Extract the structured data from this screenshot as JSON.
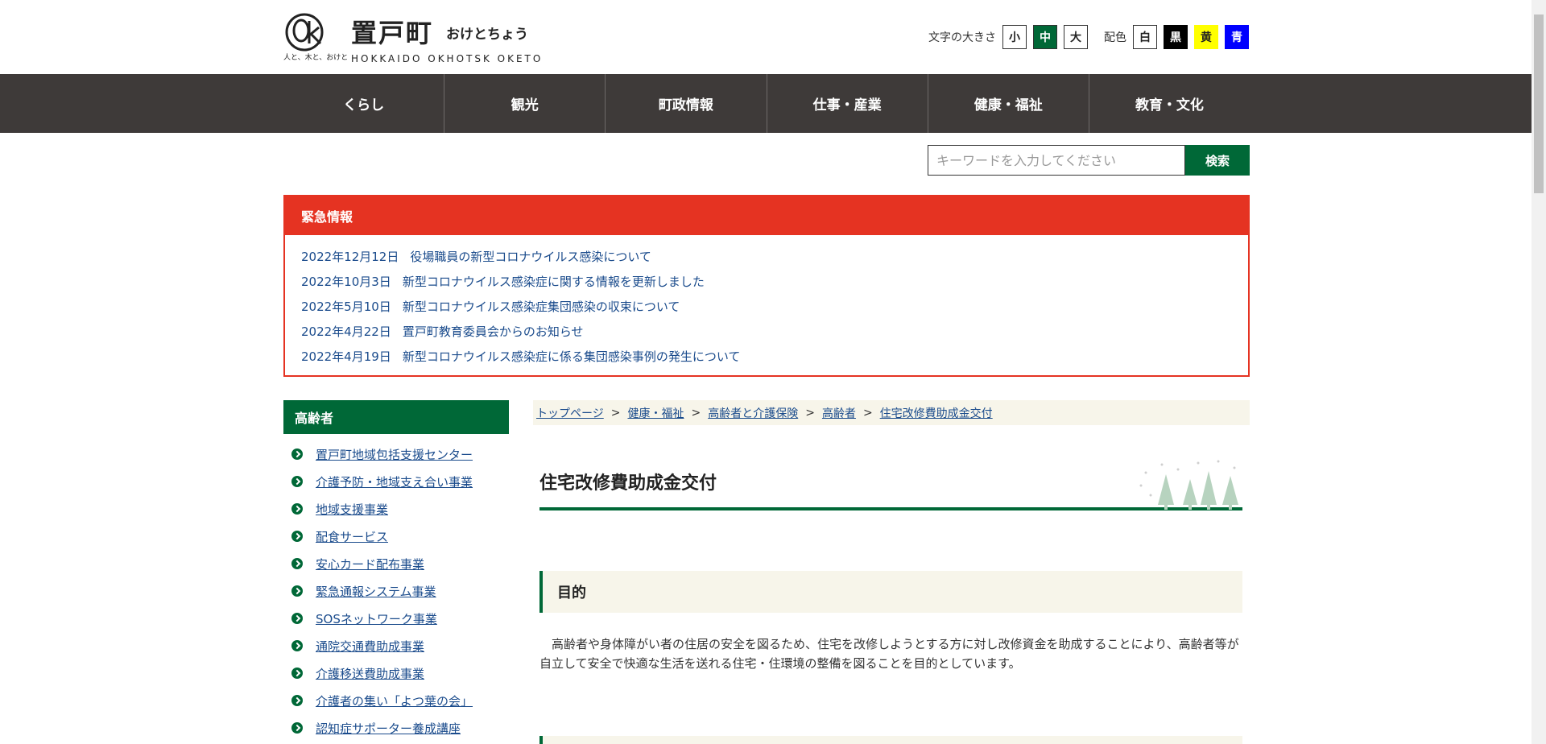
{
  "header": {
    "logo": {
      "title": "置戸町",
      "kana": "おけとちょう",
      "en": "HOKKAIDO OKHOTSK OKETO",
      "tagline": "人と、木と、おけと"
    },
    "font_size": {
      "label": "文字の大きさ",
      "small": "小",
      "medium": "中",
      "large": "大"
    },
    "color_scheme": {
      "label": "配色",
      "white": "白",
      "black": "黒",
      "yellow": "黄",
      "blue": "青"
    }
  },
  "nav": {
    "items": [
      "くらし",
      "観光",
      "町政情報",
      "仕事・産業",
      "健康・福祉",
      "教育・文化"
    ]
  },
  "search": {
    "placeholder": "キーワードを入力してください",
    "button": "検索"
  },
  "emergency": {
    "heading": "緊急情報",
    "items": [
      {
        "date": "2022年12月12日",
        "text": "役場職員の新型コロナウイルス感染について"
      },
      {
        "date": "2022年10月3日",
        "text": "新型コロナウイルス感染症に関する情報を更新しました"
      },
      {
        "date": "2022年5月10日",
        "text": "新型コロナウイルス感染症集団感染の収束について"
      },
      {
        "date": "2022年4月22日",
        "text": "置戸町教育委員会からのお知らせ"
      },
      {
        "date": "2022年4月19日",
        "text": "新型コロナウイルス感染症に係る集団感染事例の発生について"
      }
    ]
  },
  "sidebar": {
    "heading": "高齢者",
    "items": [
      "置戸町地域包括支援センター",
      "介護予防・地域支え合い事業",
      "地域支援事業",
      "配食サービス",
      "安心カード配布事業",
      "緊急通報システム事業",
      "SOSネットワーク事業",
      "通院交通費助成事業",
      "介護移送費助成事業",
      "介護者の集い「よつ葉の会」",
      "認知症サポーター養成講座"
    ]
  },
  "breadcrumb": {
    "items": [
      "トップページ",
      "健康・福祉",
      "高齢者と介護保険",
      "高齢者",
      "住宅改修費助成金交付"
    ],
    "separator": ">"
  },
  "page": {
    "title": "住宅改修費助成金交付",
    "section_heading": "目的",
    "section_body": "高齢者や身体障がい者の住居の安全を図るため、住宅を改修しようとする方に対し改修資金を助成することにより、高齢者等が自立して安全で快適な生活を送れる住宅・住環境の整備を図ることを目的としています。"
  },
  "colors": {
    "brand_green": "#006837",
    "nav_bg": "#3e3a39",
    "emergency_red": "#e53322",
    "link_blue": "#1a4b8c",
    "section_bg": "#f7f5ea"
  }
}
